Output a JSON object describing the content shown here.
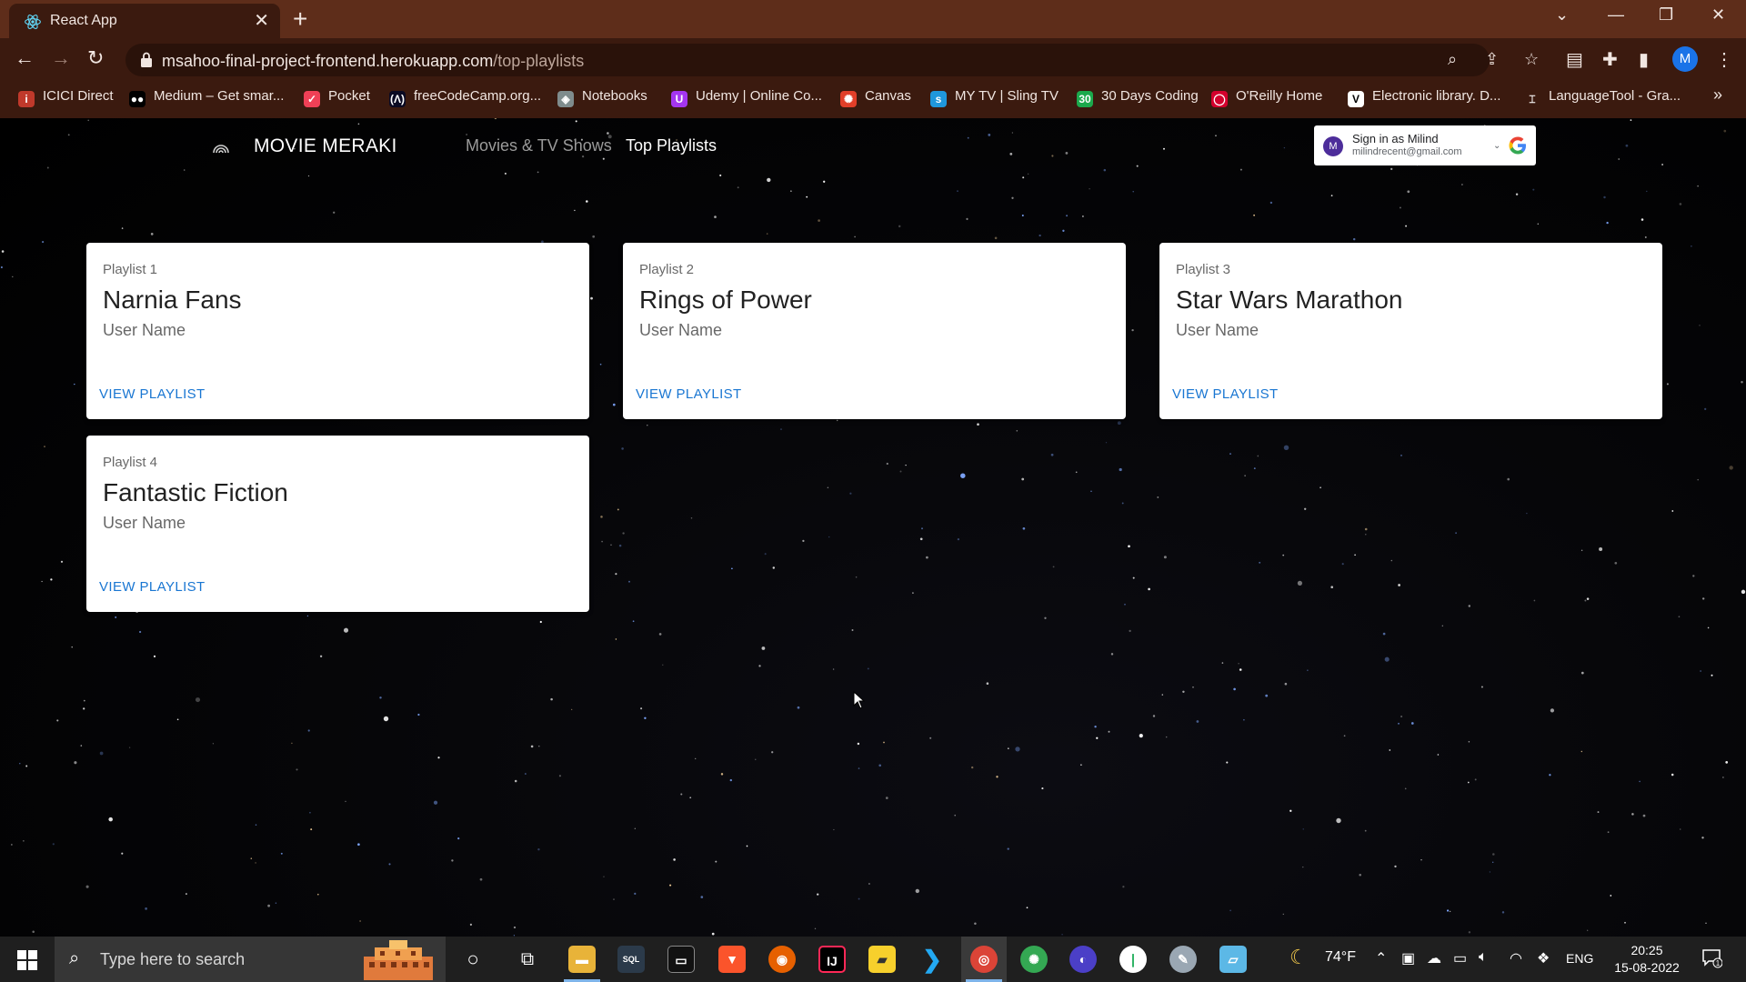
{
  "browser": {
    "tab_title": "React App",
    "url_domain": "msahoo-final-project-frontend.herokuapp.com",
    "url_path": "/top-playlists",
    "profile_initial": "M",
    "bookmarks": [
      {
        "label": "ICICI Direct",
        "color": "#c0392b",
        "glyph": "i"
      },
      {
        "label": "Medium – Get smar...",
        "color": "#000000",
        "glyph": "●●"
      },
      {
        "label": "Pocket",
        "color": "#ef4056",
        "glyph": "✓"
      },
      {
        "label": "freeCodeCamp.org...",
        "color": "#0a0a23",
        "glyph": "(Λ)"
      },
      {
        "label": "Notebooks",
        "color": "#7f8c8d",
        "glyph": "◈"
      },
      {
        "label": "Udemy | Online Co...",
        "color": "#a435f0",
        "glyph": "U"
      },
      {
        "label": "Canvas",
        "color": "#e13f29",
        "glyph": "✺"
      },
      {
        "label": "MY TV | Sling TV",
        "color": "#1f97dc",
        "glyph": "s"
      },
      {
        "label": "30 Days Coding",
        "color": "#1ba94c",
        "glyph": "30"
      },
      {
        "label": "O'Reilly Home",
        "color": "#d3002d",
        "glyph": "◯"
      },
      {
        "label": "Electronic library. D...",
        "color": "#ffffff",
        "glyph": "V"
      },
      {
        "label": "LanguageTool - Gra...",
        "color": "#3b1a0f",
        "glyph": "⌶"
      }
    ]
  },
  "app": {
    "brand": "MOVIE MERAKI",
    "nav": {
      "movies": "Movies & TV Shows",
      "top_playlists": "Top Playlists"
    },
    "google_signin": {
      "title": "Sign in as Milind",
      "email": "milindrecent@gmail.com",
      "avatar_initial": "M"
    },
    "playlists": [
      {
        "overline": "Playlist 1",
        "title": "Narnia Fans",
        "user": "User Name",
        "action": "VIEW PLAYLIST"
      },
      {
        "overline": "Playlist 2",
        "title": "Rings of Power",
        "user": "User Name",
        "action": "VIEW PLAYLIST"
      },
      {
        "overline": "Playlist 3",
        "title": "Star Wars Marathon",
        "user": "User Name",
        "action": "VIEW PLAYLIST"
      },
      {
        "overline": "Playlist 4",
        "title": "Fantastic Fiction",
        "user": "User Name",
        "action": "VIEW PLAYLIST"
      }
    ]
  },
  "taskbar": {
    "search_placeholder": "Type here to search",
    "weather": "74°F",
    "language": "ENG",
    "time": "20:25",
    "date": "15-08-2022",
    "notification_count": "1"
  }
}
